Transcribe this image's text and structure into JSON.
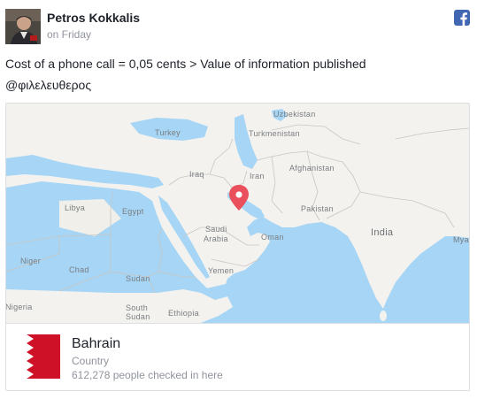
{
  "post": {
    "author": "Petros Kokkalis",
    "time": "on Friday",
    "text": "Cost of a phone call = 0,05 cents > Value of information published",
    "hashtag": "@φιλελευθερος",
    "network_icon": "facebook-icon"
  },
  "map": {
    "marker_icon": "map-pin-icon",
    "water_color": "#a6d5f5",
    "land_color": "#f3f2ef",
    "labels": {
      "uzbekistan": "Uzbekistan",
      "turkey": "Turkey",
      "turkmenistan": "Turkmenistan",
      "afghanistan": "Afghanistan",
      "iraq": "Iraq",
      "iran": "Iran",
      "libya": "Libya",
      "egypt": "Egypt",
      "pakistan": "Pakistan",
      "saudi": "Saudi",
      "arabia": "Arabia",
      "oman": "Oman",
      "india": "India",
      "mya": "Mya",
      "niger": "Niger",
      "chad": "Chad",
      "yemen": "Yemen",
      "sudan": "Sudan",
      "south": "South",
      "sudan2": "Sudan",
      "ethiopia": "Ethiopia",
      "nigeria": "Nigeria"
    }
  },
  "place": {
    "name": "Bahrain",
    "type": "Country",
    "checkins": "612,278 people checked in here",
    "flag_color": "#ce1126"
  }
}
